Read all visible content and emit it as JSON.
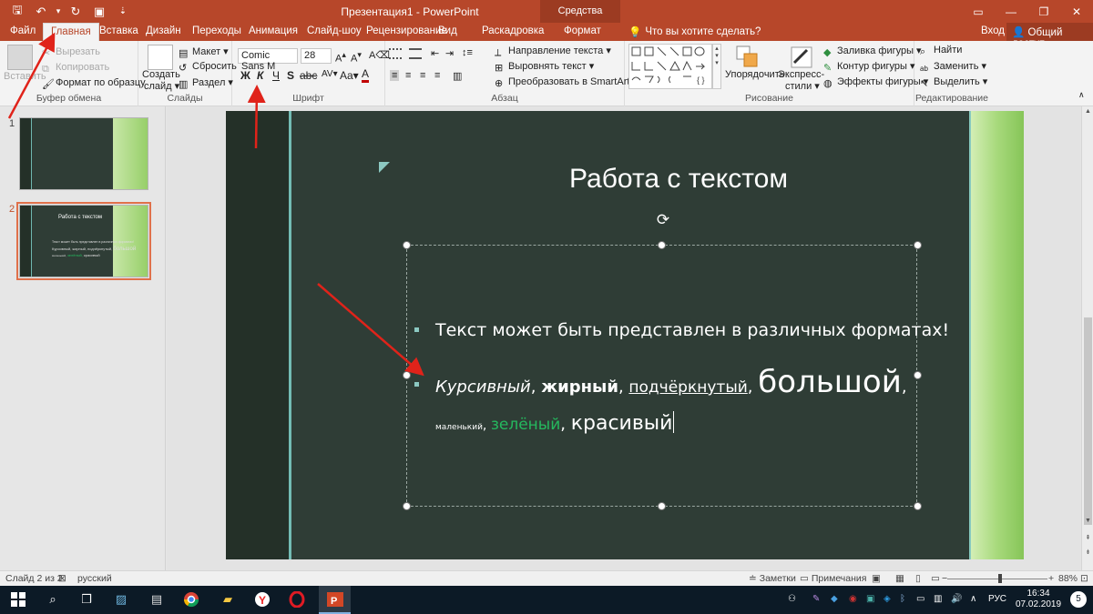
{
  "window": {
    "title": "Презентация1 - PowerPoint",
    "context_header": "Средства рисования",
    "controls": {
      "ribbon_options": "▭",
      "minimize": "—",
      "maximize": "❐",
      "close": "✕"
    }
  },
  "qat": {
    "save": "🖫",
    "undo": "↶",
    "undo_dropdown": "▾",
    "redo": "↻",
    "start": "▣",
    "customize": "⇣"
  },
  "tabs": [
    {
      "label": "Файл"
    },
    {
      "label": "Главная"
    },
    {
      "label": "Вставка"
    },
    {
      "label": "Дизайн"
    },
    {
      "label": "Переходы"
    },
    {
      "label": "Анимация"
    },
    {
      "label": "Слайд-шоу"
    },
    {
      "label": "Рецензирование"
    },
    {
      "label": "Вид"
    },
    {
      "label": "Раскадровка"
    },
    {
      "label": "Формат"
    }
  ],
  "tell_me": "Что вы хотите сделать?",
  "sign_in": "Вход",
  "share": "Общий доступ",
  "ribbon": {
    "clipboard": {
      "paste": "Вставить",
      "cut": "Вырезать",
      "copy": "Копировать",
      "format_painter": "Формат по образцу",
      "label": "Буфер обмена"
    },
    "slides": {
      "new_slide_1": "Создать",
      "new_slide_2": "слайд ▾",
      "layout": "Макет ▾",
      "reset": "Сбросить",
      "section": "Раздел ▾",
      "label": "Слайды"
    },
    "font": {
      "font_name": "Comic Sans M",
      "font_size": "28",
      "bold": "Ж",
      "italic": "К",
      "underline": "Ч",
      "strike": "S",
      "label": "Шрифт"
    },
    "paragraph": {
      "text_direction": "Направление текста ▾",
      "align_text": "Выровнять текст ▾",
      "smartart": "Преобразовать в SmartArt ▾",
      "label": "Абзац"
    },
    "drawing": {
      "arrange": "Упорядочить",
      "quick_styles_1": "Экспресс-",
      "quick_styles_2": "стили ▾",
      "fill": "Заливка фигуры ▾",
      "outline": "Контур фигуры ▾",
      "effects": "Эффекты фигуры ▾",
      "label": "Рисование"
    },
    "editing": {
      "find": "Найти",
      "replace": "Заменить ▾",
      "select": "Выделить ▾",
      "label": "Редактирование"
    }
  },
  "slides_pane": [
    {
      "number": "1"
    },
    {
      "number": "2",
      "title": "Работа с текстом",
      "line1": "Текст может быть представлен в различных форматах!",
      "line2a": "Курсивный, жирный, подчёркнутый,",
      "line2b": "большой",
      "line3a": "маленький,",
      "line3b": "зелёный,",
      "line3c": "красивый"
    }
  ],
  "slide": {
    "title": "Работа с текстом",
    "bullet1": "Текст может быть представлен в различных форматах!",
    "bullet2": {
      "italic": "Курсивный",
      "sep1": ", ",
      "bold": "жирный",
      "sep2": ", ",
      "underline": "подчёркнутый",
      "sep3": ", ",
      "big": "большой",
      "sep4": ","
    },
    "bullet2_line2": {
      "small": "маленький",
      "sep1": ", ",
      "green": "зелёный",
      "sep2": ", ",
      "pretty": "красивый"
    }
  },
  "status": {
    "slide_of": "Слайд 2 из 2",
    "language": "русский",
    "notes": "Заметки",
    "comments": "Примечания",
    "zoom": "88%"
  },
  "taskbar": {
    "time": "16:34",
    "date": "07.02.2019",
    "lang": "РУС",
    "notifications": "5"
  },
  "colors": {
    "accent": "#b7472a",
    "slide_bg": "#2f3d36",
    "green_text": "#25b85e"
  }
}
